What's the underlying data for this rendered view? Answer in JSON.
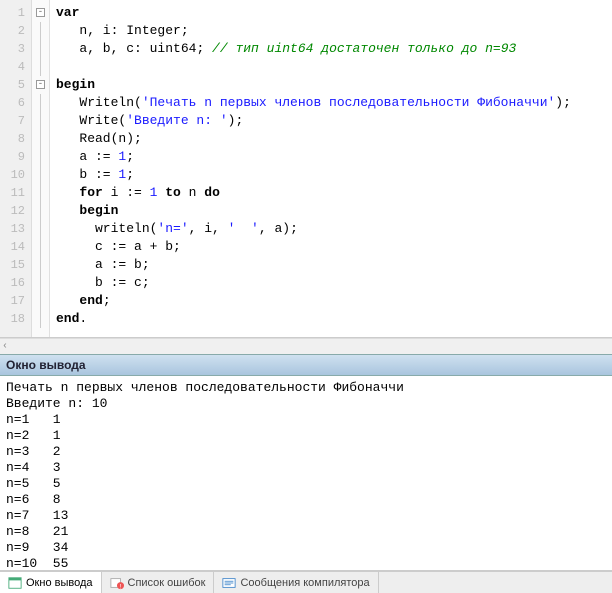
{
  "editor": {
    "line_numbers": [
      "1",
      "2",
      "3",
      "4",
      "5",
      "6",
      "7",
      "8",
      "9",
      "10",
      "11",
      "12",
      "13",
      "14",
      "15",
      "16",
      "17",
      "18"
    ],
    "fold_markers": {
      "1": "-",
      "5": "-"
    },
    "code_lines": [
      {
        "indent": "",
        "tokens": [
          {
            "t": "var",
            "c": "kw"
          }
        ]
      },
      {
        "indent": "   ",
        "tokens": [
          {
            "t": "n, i: ",
            "c": ""
          },
          {
            "t": "Integer",
            "c": "typ"
          },
          {
            "t": ";",
            "c": ""
          }
        ]
      },
      {
        "indent": "   ",
        "tokens": [
          {
            "t": "a, b, c: ",
            "c": ""
          },
          {
            "t": "uint64",
            "c": "typ"
          },
          {
            "t": "; ",
            "c": ""
          },
          {
            "t": "// тип uint64 достаточен только до n=93",
            "c": "com"
          }
        ]
      },
      {
        "indent": "",
        "tokens": []
      },
      {
        "indent": "",
        "tokens": [
          {
            "t": "begin",
            "c": "kw"
          }
        ]
      },
      {
        "indent": "   ",
        "tokens": [
          {
            "t": "Writeln(",
            "c": ""
          },
          {
            "t": "'Печать n первых членов последовательности Фибоначчи'",
            "c": "str"
          },
          {
            "t": ");",
            "c": ""
          }
        ]
      },
      {
        "indent": "   ",
        "tokens": [
          {
            "t": "Write(",
            "c": ""
          },
          {
            "t": "'Введите n: '",
            "c": "str"
          },
          {
            "t": ");",
            "c": ""
          }
        ]
      },
      {
        "indent": "   ",
        "tokens": [
          {
            "t": "Read(n);",
            "c": ""
          }
        ]
      },
      {
        "indent": "   ",
        "tokens": [
          {
            "t": "a := ",
            "c": ""
          },
          {
            "t": "1",
            "c": "num"
          },
          {
            "t": ";",
            "c": ""
          }
        ]
      },
      {
        "indent": "   ",
        "tokens": [
          {
            "t": "b := ",
            "c": ""
          },
          {
            "t": "1",
            "c": "num"
          },
          {
            "t": ";",
            "c": ""
          }
        ]
      },
      {
        "indent": "   ",
        "tokens": [
          {
            "t": "for",
            "c": "kw"
          },
          {
            "t": " i := ",
            "c": ""
          },
          {
            "t": "1",
            "c": "num"
          },
          {
            "t": " ",
            "c": ""
          },
          {
            "t": "to",
            "c": "kw"
          },
          {
            "t": " n ",
            "c": ""
          },
          {
            "t": "do",
            "c": "kw"
          }
        ]
      },
      {
        "indent": "   ",
        "tokens": [
          {
            "t": "begin",
            "c": "kw"
          }
        ]
      },
      {
        "indent": "     ",
        "tokens": [
          {
            "t": "writeln(",
            "c": ""
          },
          {
            "t": "'n='",
            "c": "str"
          },
          {
            "t": ", i, ",
            "c": ""
          },
          {
            "t": "'  '",
            "c": "str"
          },
          {
            "t": ", a);",
            "c": ""
          }
        ]
      },
      {
        "indent": "     ",
        "tokens": [
          {
            "t": "c := a + b;",
            "c": ""
          }
        ]
      },
      {
        "indent": "     ",
        "tokens": [
          {
            "t": "a := b;",
            "c": ""
          }
        ]
      },
      {
        "indent": "     ",
        "tokens": [
          {
            "t": "b := c;",
            "c": ""
          }
        ]
      },
      {
        "indent": "   ",
        "tokens": [
          {
            "t": "end",
            "c": "kw"
          },
          {
            "t": ";",
            "c": ""
          }
        ]
      },
      {
        "indent": "",
        "tokens": [
          {
            "t": "end",
            "c": "kw"
          },
          {
            "t": ".",
            "c": ""
          }
        ]
      }
    ]
  },
  "output": {
    "title": "Окно вывода",
    "lines": [
      "Печать n первых членов последовательности Фибоначчи",
      "Введите n: 10",
      "n=1   1",
      "n=2   1",
      "n=3   2",
      "n=4   3",
      "n=5   5",
      "n=6   8",
      "n=7   13",
      "n=8   21",
      "n=9   34",
      "n=10  55"
    ]
  },
  "tabs": {
    "t1": "Окно вывода",
    "t2": "Список ошибок",
    "t3": "Сообщения компилятора"
  },
  "scroll_glyph": "‹"
}
